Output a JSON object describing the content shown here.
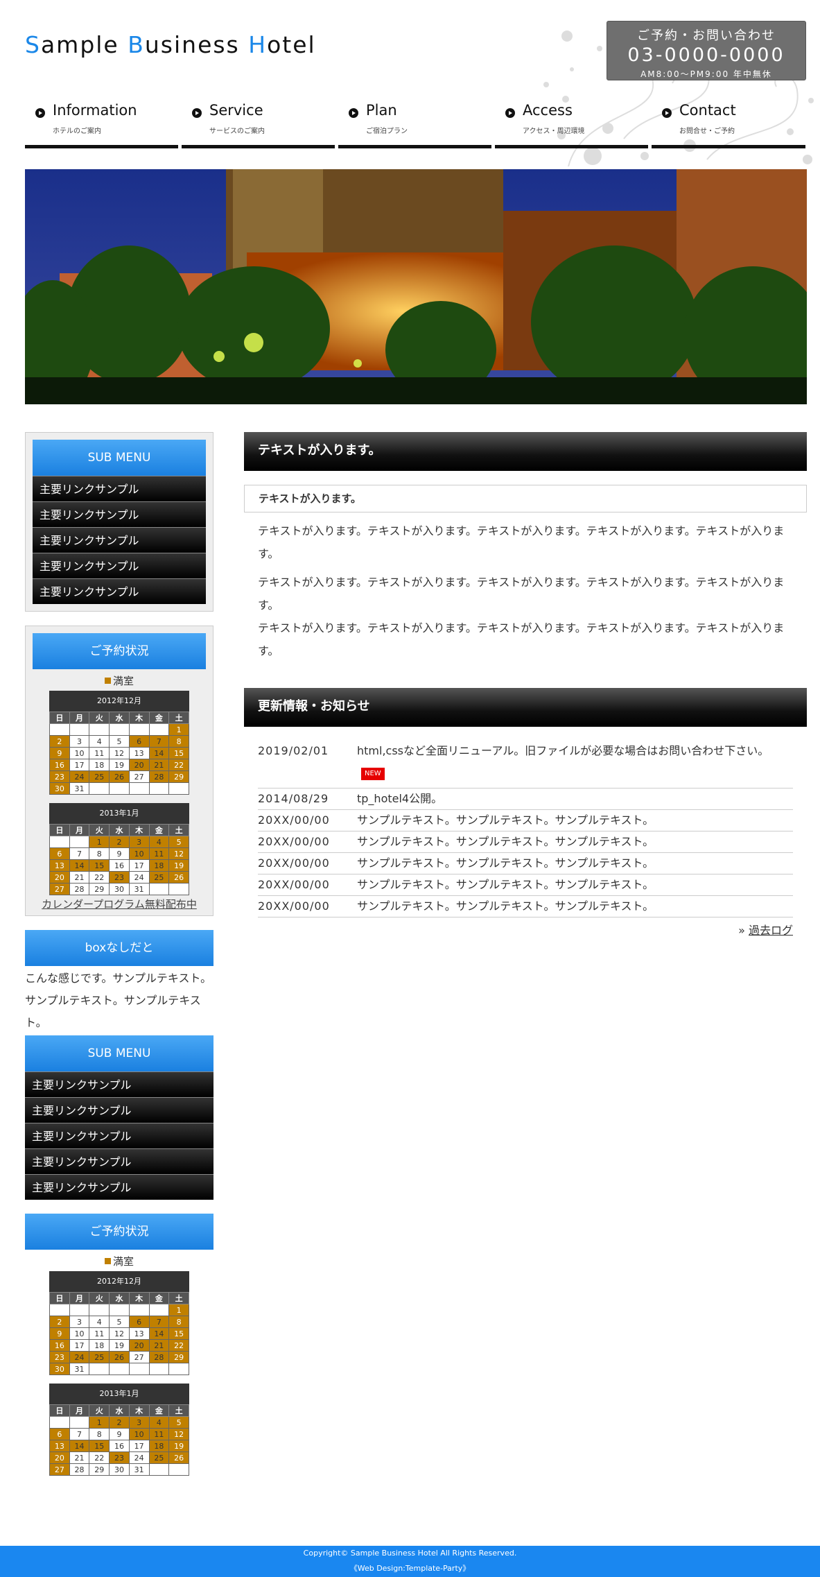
{
  "site": {
    "logo_parts": [
      "S",
      "ample ",
      "B",
      "usiness ",
      "H",
      "otel"
    ],
    "contact": {
      "line1": "ご予約・お問い合わせ",
      "tel": "03-0000-0000",
      "hours": "AM8:00～PM9:00 年中無休"
    }
  },
  "nav": [
    {
      "en": "Information",
      "jp": "ホテルのご案内"
    },
    {
      "en": "Service",
      "jp": "サービスのご案内"
    },
    {
      "en": "Plan",
      "jp": "ご宿泊プラン"
    },
    {
      "en": "Access",
      "jp": "アクセス・周辺環境"
    },
    {
      "en": "Contact",
      "jp": "お問合せ・ご予約"
    }
  ],
  "sidebar": {
    "submenu_title": "SUB MENU",
    "links": [
      "主要リンクサンプル",
      "主要リンクサンプル",
      "主要リンクサンプル",
      "主要リンクサンプル",
      "主要リンクサンプル"
    ],
    "reserve_title": "ご予約状況",
    "legend": "満室",
    "cal_link": "カレンダープログラム無料配布中",
    "plain_title": "boxなしだと",
    "plain_text": "こんな感じです。サンプルテキスト。サンプルテキスト。サンプルテキスト。",
    "weekdays": [
      "日",
      "月",
      "火",
      "水",
      "木",
      "金",
      "土"
    ],
    "calendars": [
      {
        "title": "2012年12月",
        "weeks": [
          [
            "",
            "",
            "",
            "",
            "",
            "",
            "1"
          ],
          [
            "2",
            "3",
            "4",
            "5",
            "6",
            "7",
            "8"
          ],
          [
            "9",
            "10",
            "11",
            "12",
            "13",
            "14",
            "15"
          ],
          [
            "16",
            "17",
            "18",
            "19",
            "20",
            "21",
            "22"
          ],
          [
            "23",
            "24",
            "25",
            "26",
            "27",
            "28",
            "29"
          ],
          [
            "30",
            "31",
            "",
            "",
            "",
            "",
            ""
          ]
        ],
        "full": [
          "1",
          "2",
          "6",
          "7",
          "8",
          "9",
          "14",
          "15",
          "16",
          "20",
          "21",
          "22",
          "23",
          "24",
          "25",
          "26",
          "28",
          "29",
          "30"
        ]
      },
      {
        "title": "2013年1月",
        "weeks": [
          [
            "",
            "",
            "1",
            "2",
            "3",
            "4",
            "5"
          ],
          [
            "6",
            "7",
            "8",
            "9",
            "10",
            "11",
            "12"
          ],
          [
            "13",
            "14",
            "15",
            "16",
            "17",
            "18",
            "19"
          ],
          [
            "20",
            "21",
            "22",
            "23",
            "24",
            "25",
            "26"
          ],
          [
            "27",
            "28",
            "29",
            "30",
            "31",
            "",
            ""
          ]
        ],
        "full": [
          "1",
          "2",
          "3",
          "4",
          "5",
          "6",
          "10",
          "11",
          "12",
          "13",
          "14",
          "15",
          "18",
          "19",
          "20",
          "23",
          "25",
          "26",
          "27"
        ]
      }
    ]
  },
  "main": {
    "heading": "テキストが入ります。",
    "subheading": "テキストが入ります。",
    "paragraphs": [
      "テキストが入ります。テキストが入ります。テキストが入ります。テキストが入ります。テキストが入ります。",
      "テキストが入ります。テキストが入ります。テキストが入ります。テキストが入ります。テキストが入ります。\nテキストが入ります。テキストが入ります。テキストが入ります。テキストが入ります。テキストが入ります。"
    ],
    "news_title": "更新情報・お知らせ",
    "news": [
      {
        "date": "2019/02/01",
        "text": "html,cssなど全面リニューアル。旧ファイルが必要な場合はお問い合わせ下さい。",
        "new": true
      },
      {
        "date": "2014/08/29",
        "text": "tp_hotel4公開。"
      },
      {
        "date": "20XX/00/00",
        "text": "サンプルテキスト。サンプルテキスト。サンプルテキスト。"
      },
      {
        "date": "20XX/00/00",
        "text": "サンプルテキスト。サンプルテキスト。サンプルテキスト。"
      },
      {
        "date": "20XX/00/00",
        "text": "サンプルテキスト。サンプルテキスト。サンプルテキスト。"
      },
      {
        "date": "20XX/00/00",
        "text": "サンプルテキスト。サンプルテキスト。サンプルテキスト。"
      },
      {
        "date": "20XX/00/00",
        "text": "サンプルテキスト。サンプルテキスト。サンプルテキスト。"
      }
    ],
    "new_badge": "NEW",
    "more_prefix": "» ",
    "more_label": "過去ログ"
  },
  "footer": {
    "copyright": "Copyright© Sample Business Hotel All Rights Reserved.",
    "design": "《Web Design:Template-Party》"
  },
  "colors": {
    "accent": "#1a87e8",
    "full": "#c08000"
  }
}
